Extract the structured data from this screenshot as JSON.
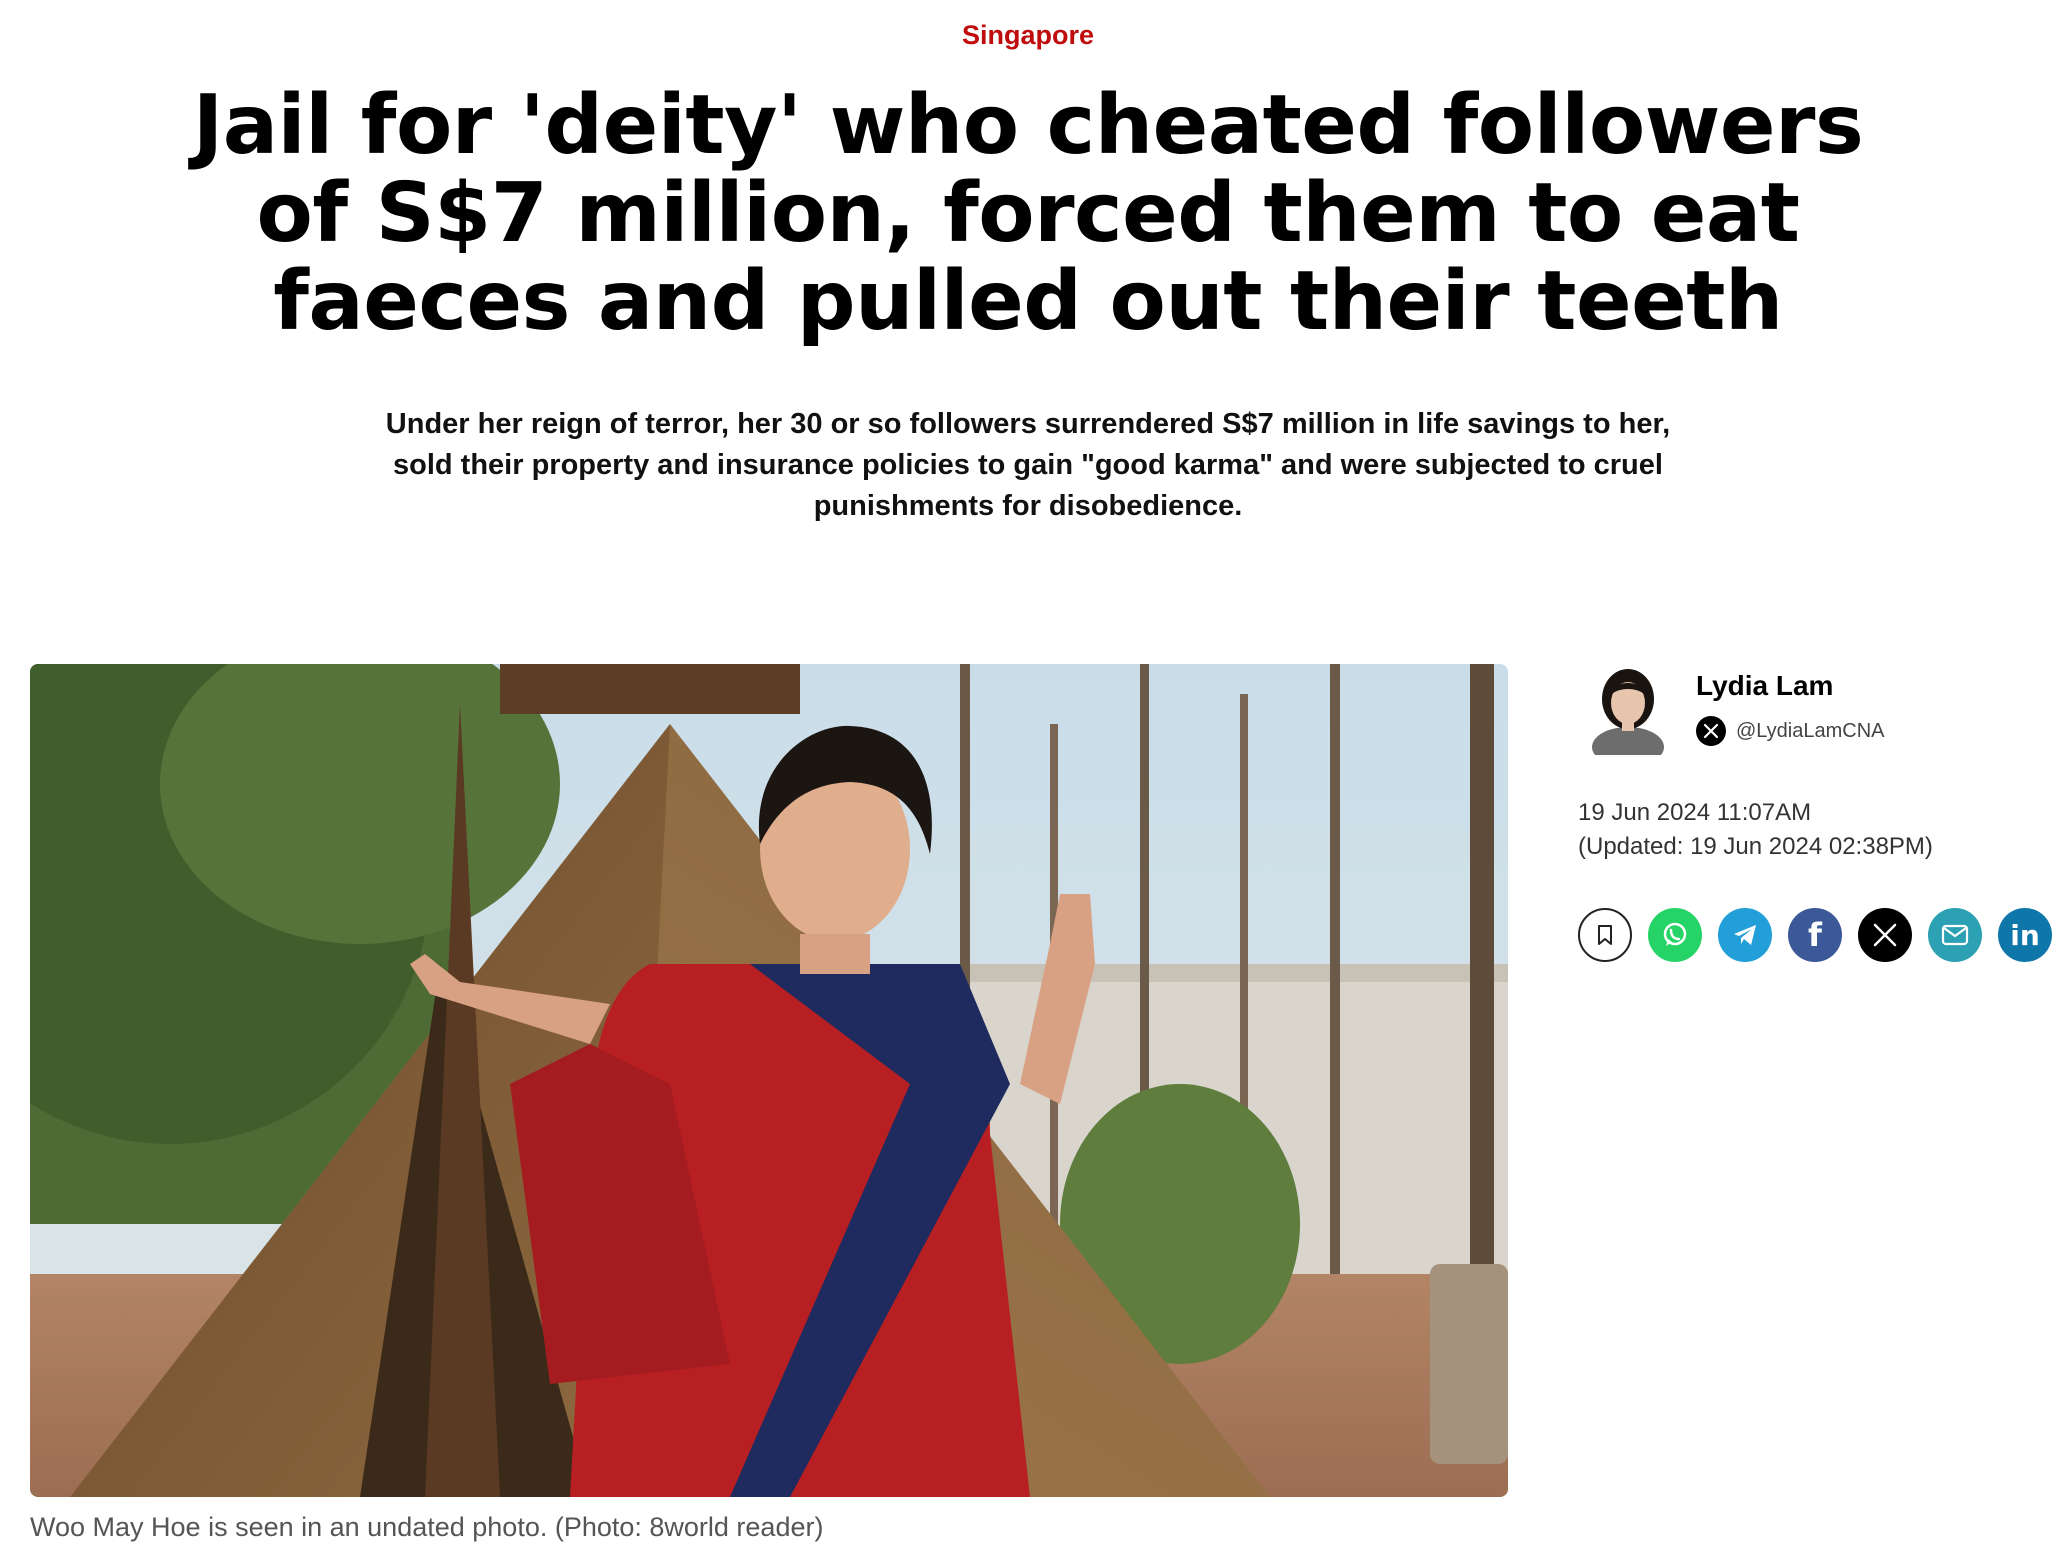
{
  "section": {
    "label": "Singapore",
    "color": "#c00c0c"
  },
  "article": {
    "headline": "Jail for 'deity' who cheated followers of S$7 million, forced them to eat faeces and pulled out their teeth",
    "summary": "Under her reign of terror, her 30 or so followers surrendered S$7 million in life savings to her, sold their property and insurance policies to gain \"good karma\" and were subjected to cruel punishments for disobedience.",
    "image_caption": "Woo May Hoe is seen in an undated photo. (Photo: 8world reader)"
  },
  "author": {
    "name": "Lydia Lam",
    "x_handle": "@LydiaLamCNA"
  },
  "dates": {
    "published": "19 Jun 2024 11:07AM",
    "updated": "(Updated: 19 Jun 2024 02:38PM)"
  },
  "share_buttons": [
    {
      "name": "bookmark-icon",
      "color": "#ffffff"
    },
    {
      "name": "whatsapp-icon",
      "color": "#25d366"
    },
    {
      "name": "telegram-icon",
      "color": "#229ed9"
    },
    {
      "name": "facebook-icon",
      "color": "#3b5998"
    },
    {
      "name": "x-icon",
      "color": "#000000"
    },
    {
      "name": "email-icon",
      "color": "#2ba1b3"
    },
    {
      "name": "linkedin-icon",
      "color": "#0e76a8"
    }
  ],
  "share_glyphs": {
    "facebook": "f",
    "linkedin": "in"
  }
}
